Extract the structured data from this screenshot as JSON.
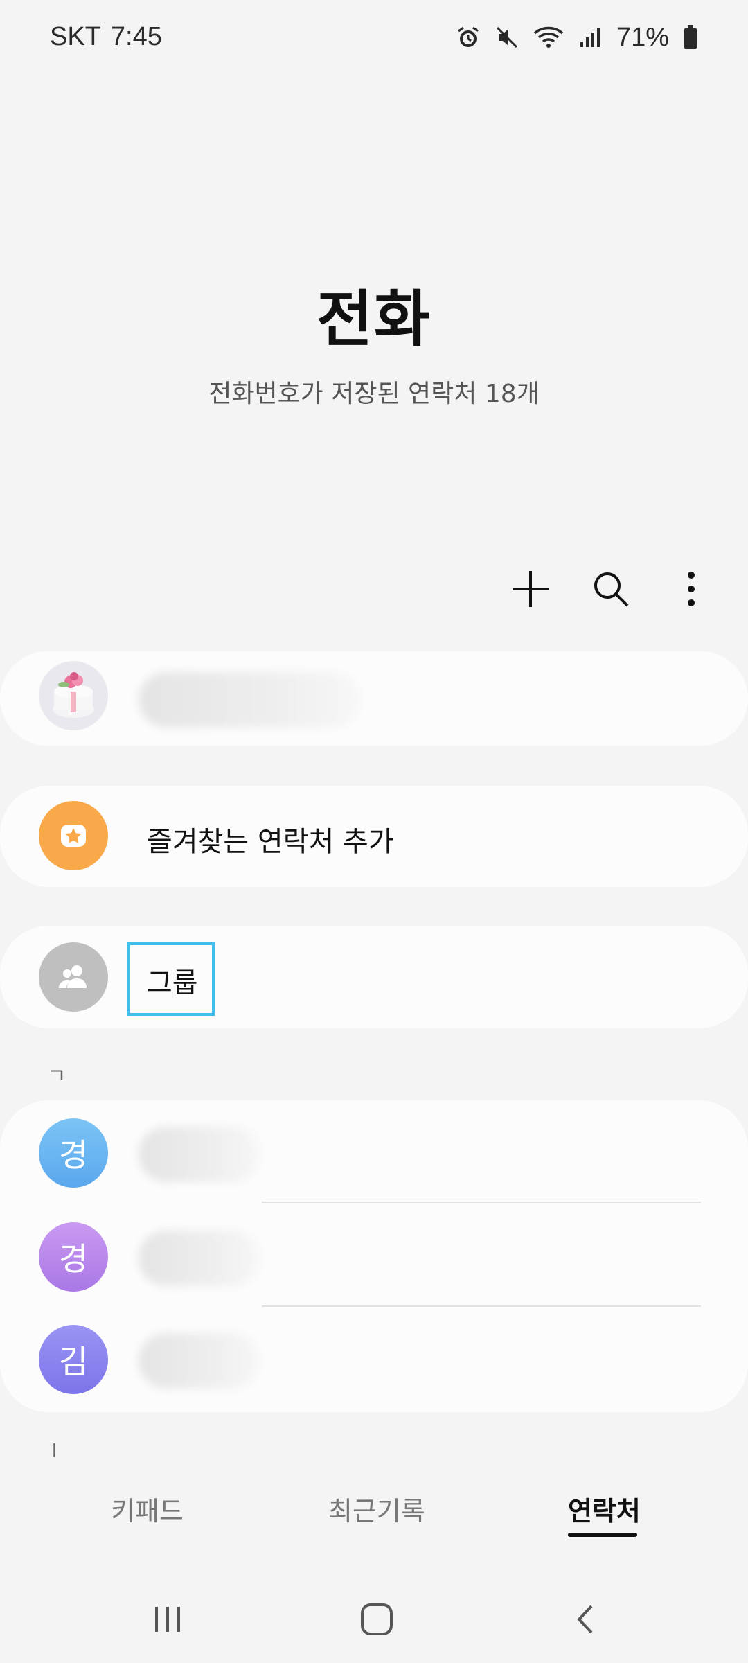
{
  "status_bar": {
    "carrier": "SKT",
    "time": "7:45",
    "battery_percent": "71%",
    "icons": [
      "alarm-icon",
      "mute-icon",
      "wifi-icon",
      "signal-icon",
      "battery-icon"
    ]
  },
  "header": {
    "title": "전화",
    "subtitle": "전화번호가 저장된 연락처 18개"
  },
  "toolbar": {
    "icons": [
      "plus-icon",
      "search-icon",
      "more-options-icon"
    ]
  },
  "profile": {
    "avatar_icon": "cake-photo"
  },
  "favorites": {
    "label": "즐겨찾는 연락처 추가",
    "icon": "star-icon",
    "color": "#f9a94a"
  },
  "groups": {
    "label": "그룹",
    "icon": "group-icon",
    "color": "#bfbfbf"
  },
  "section_index": {
    "first": "ㄱ",
    "next": "ㅣ"
  },
  "contacts": [
    {
      "initial": "경",
      "color_top": "#7cc4f5",
      "color_bottom": "#5aa7ee"
    },
    {
      "initial": "경",
      "color_top": "#c99af1",
      "color_bottom": "#a978e6"
    },
    {
      "initial": "김",
      "color_top": "#9a94f3",
      "color_bottom": "#7c75ea"
    }
  ],
  "tabs": {
    "keypad": "키패드",
    "recent": "최근기록",
    "contacts": "연락처",
    "active": "contacts"
  },
  "nav": {
    "icons": [
      "recent-apps-icon",
      "home-icon",
      "back-icon"
    ]
  },
  "colors": {
    "highlight_box": "#3fbfea",
    "card": "#fcfcfc",
    "background": "#f4f4f4"
  }
}
